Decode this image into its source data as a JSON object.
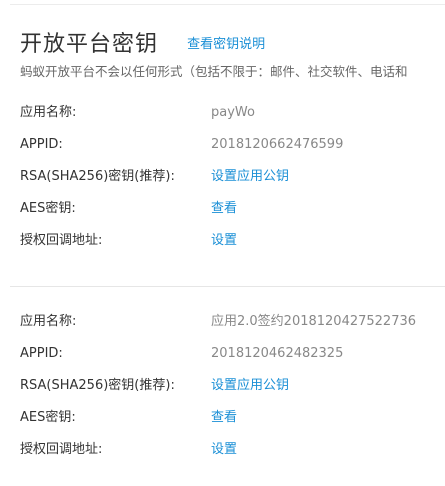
{
  "header": {
    "title": "开放平台密钥",
    "help_link": "查看密钥说明"
  },
  "notice": "蚂蚁开放平台不会以任何形式（包括不限于：邮件、社交软件、电话和",
  "apps": [
    {
      "name_label": "应用名称:",
      "name_value": "payWo",
      "appid_label": "APPID:",
      "appid_value": "2018120662476599",
      "rsa_label": "RSA(SHA256)密钥(推荐):",
      "rsa_link": "设置应用公钥",
      "aes_label": "AES密钥:",
      "aes_link": "查看",
      "callback_label": "授权回调地址:",
      "callback_link": "设置"
    },
    {
      "name_label": "应用名称:",
      "name_value": "应用2.0签约2018120427522736",
      "appid_label": "APPID:",
      "appid_value": "2018120462482325",
      "rsa_label": "RSA(SHA256)密钥(推荐):",
      "rsa_link": "设置应用公钥",
      "aes_label": "AES密钥:",
      "aes_link": "查看",
      "callback_label": "授权回调地址:",
      "callback_link": "设置"
    }
  ],
  "colors": {
    "link": "#1a8fd6",
    "label": "#333333",
    "value": "#888888"
  }
}
